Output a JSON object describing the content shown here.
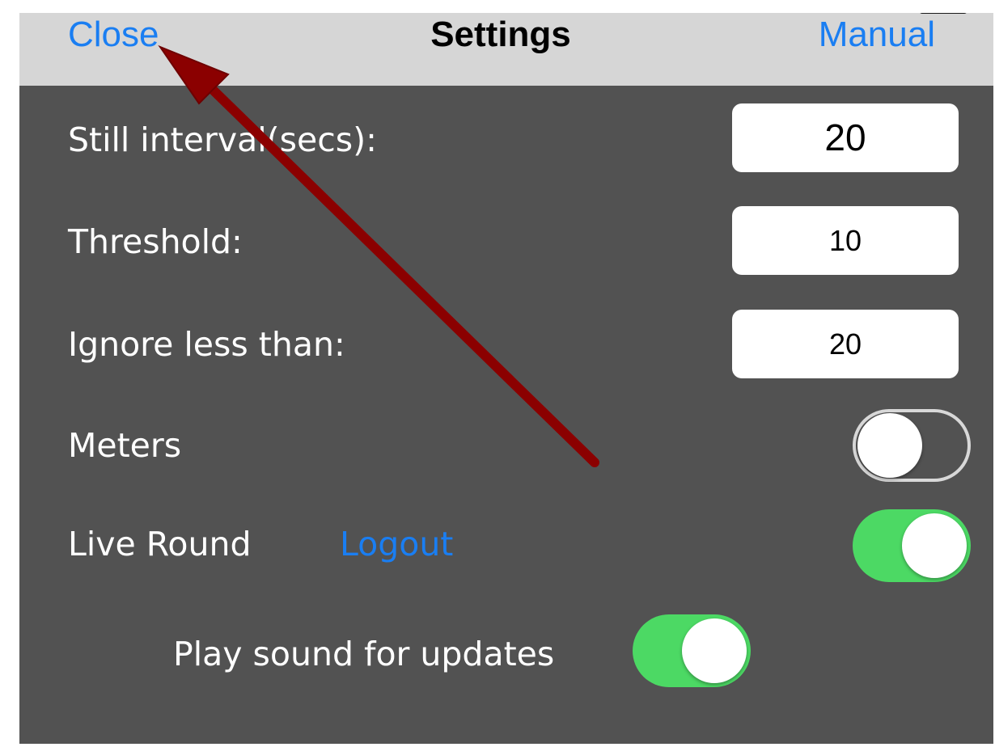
{
  "nav": {
    "close_label": "Close",
    "title": "Settings",
    "manual_label": "Manual"
  },
  "settings": {
    "still_interval": {
      "label": "Still interval(secs):",
      "value": "20"
    },
    "threshold": {
      "label": "Threshold:",
      "value": "10"
    },
    "ignore_less_than": {
      "label": "Ignore less than:",
      "value": "20"
    },
    "meters": {
      "label": "Meters",
      "enabled": false
    },
    "live_round": {
      "label": "Live Round",
      "logout_label": "Logout",
      "enabled": true
    },
    "play_sound": {
      "label": "Play sound for updates",
      "enabled": true
    }
  },
  "colors": {
    "accent": "#1a7ef2",
    "toggle_on": "#4cd964",
    "background": "#525252",
    "nav_bar": "#d6d6d6",
    "annotation_arrow": "#8b0000"
  },
  "icons": {
    "annotation": "arrow-icon"
  }
}
